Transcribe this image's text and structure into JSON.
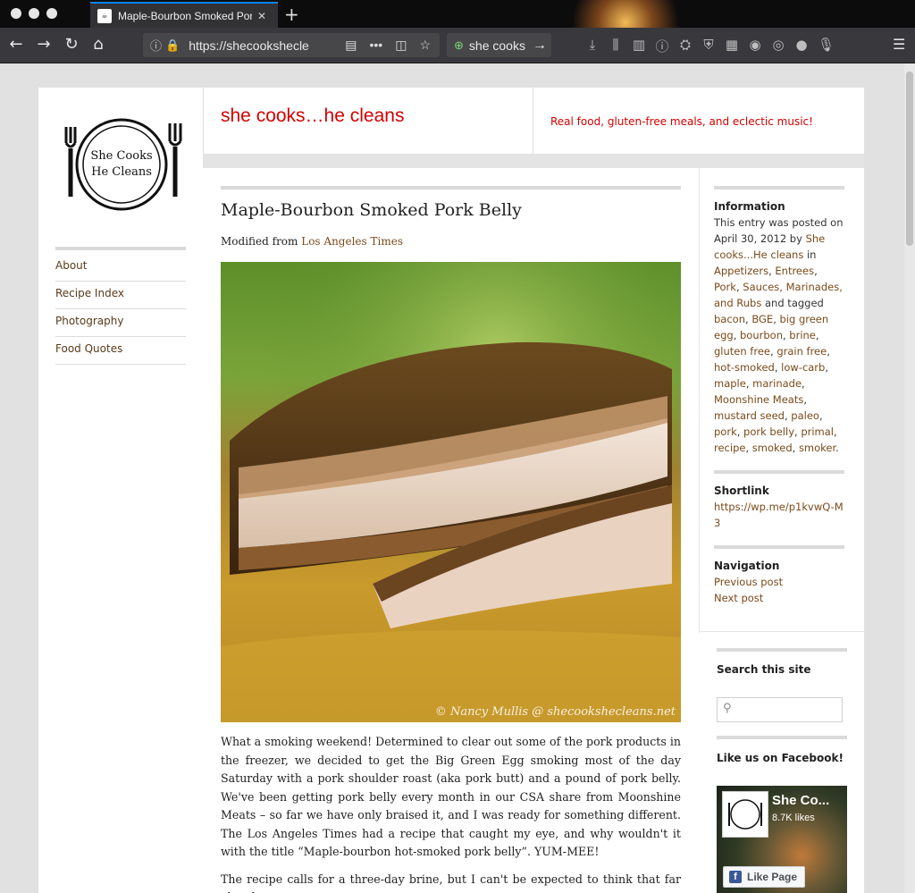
{
  "browser": {
    "tab_title": "Maple-Bourbon Smoked Pork B",
    "url": "https://shecookshecle",
    "search_text": "she cooks"
  },
  "site": {
    "title": "she cooks…he cleans",
    "tagline": "Real food, gluten-free meals, and eclectic music!",
    "logo_line1": "She Cooks",
    "logo_line2": "He Cleans"
  },
  "nav": {
    "items": [
      "About",
      "Recipe Index",
      "Photography",
      "Food Quotes"
    ]
  },
  "post": {
    "title": "Maple-Bourbon Smoked Pork Belly",
    "modified_prefix": "Modified from ",
    "modified_link": "Los Angeles Times",
    "photo_credit": "© Nancy Mullis @ shecookshecleans.net",
    "paragraph1": "What a smoking weekend!  Determined to clear out some of the pork products in the freezer, we decided to get the Big Green Egg smoking most of the day Saturday with a pork shoulder roast (aka pork butt) and a pound of pork belly.  We've been getting pork belly every month in our CSA share from Moonshine Meats – so far we have only braised it, and I was ready for something different.  The Los Angeles Times had a recipe that caught my eye, and why wouldn't it with the title “Maple-bourbon hot-smoked pork belly”.  YUM-MEE!",
    "paragraph2": "The recipe calls for a three-day brine, but I can't be expected to think that far ahead."
  },
  "meta": {
    "info_heading": "Information",
    "posted_text": "This entry was posted on April 30, 2012 by ",
    "author": "She cooks...He cleans",
    "in_text": " in ",
    "categories": [
      "Appetizers",
      "Entrees",
      "Pork",
      "Sauces, Marinades, and Rubs"
    ],
    "tagged_text": " and tagged ",
    "tags": [
      "bacon",
      "BGE",
      "big green egg",
      "bourbon",
      "brine",
      "gluten free",
      "grain free",
      "hot-smoked",
      "low-carb",
      "maple",
      "marinade",
      "Moonshine Meats",
      "mustard seed",
      "paleo",
      "pork",
      "pork belly",
      "primal",
      "recipe",
      "smoked",
      "smoker"
    ],
    "shortlink_heading": "Shortlink",
    "shortlink": "https://wp.me/p1kvwQ-M3",
    "navigation_heading": "Navigation",
    "prev": "Previous post",
    "next": "Next post"
  },
  "widgets": {
    "search_heading": "Search this site",
    "facebook_heading": "Like us on Facebook!",
    "fb_page_name": "She Co...",
    "fb_likes": "8.7K likes",
    "fb_button": "Like Page"
  }
}
